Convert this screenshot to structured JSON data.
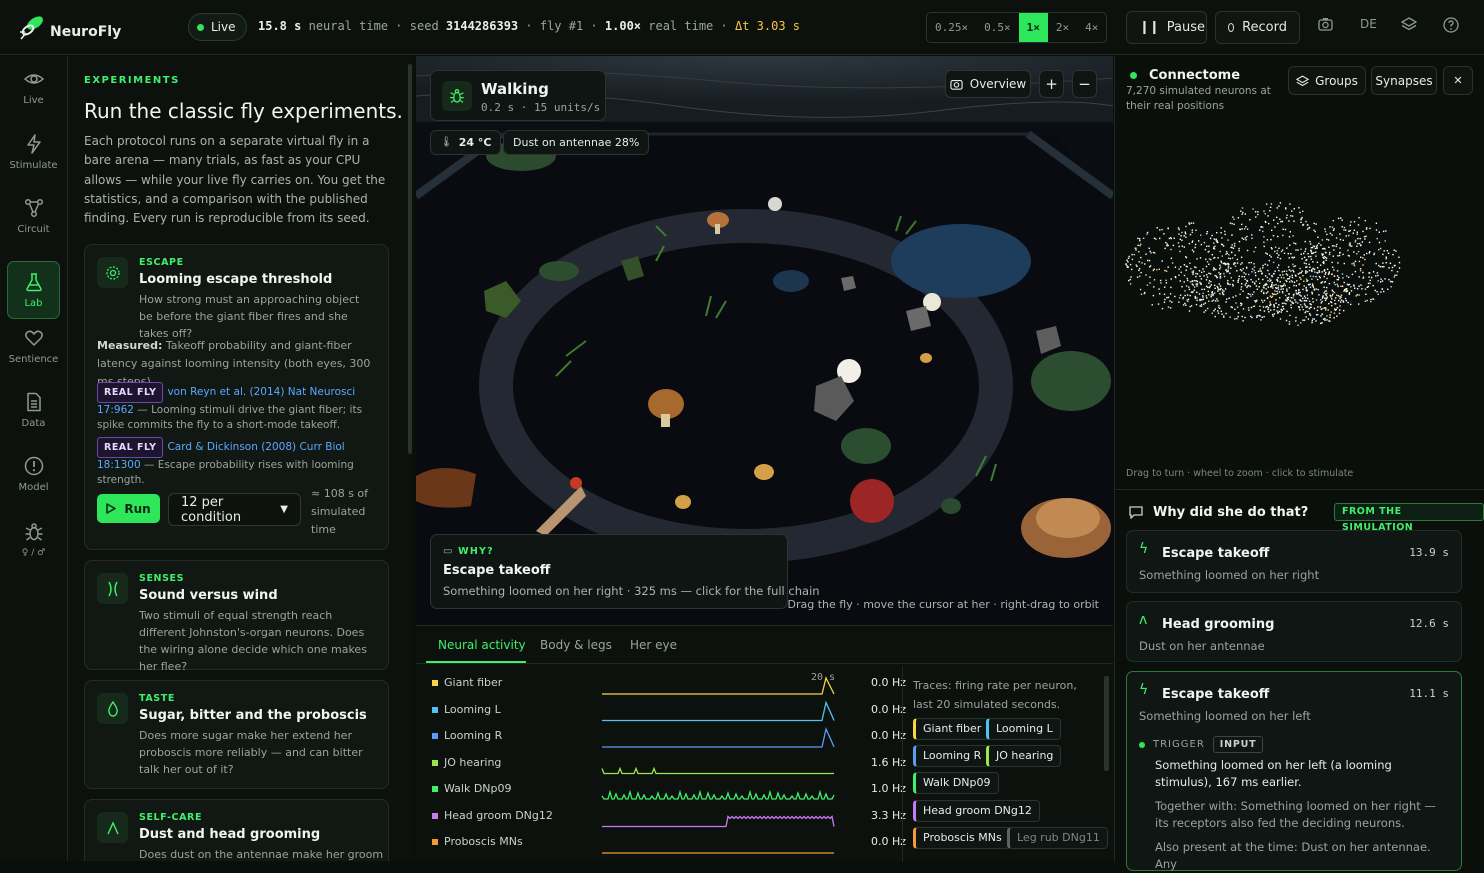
{
  "app": {
    "name": "NeuroFly"
  },
  "topbar": {
    "live_label": "Live",
    "time_value": "15.8 s",
    "time_label": "neural time",
    "seed_label": "seed",
    "seed_value": "3144286393",
    "fly_label": "fly #1",
    "ratio_value": "1.00×",
    "ratio_label": "real time",
    "dt_label": "Δt 3.03 s",
    "speeds": [
      "0.25×",
      "0.5×",
      "1×",
      "2×",
      "4×"
    ],
    "active_speed": "1×",
    "pause_label": "Pause",
    "record_label": "Record",
    "lang_label": "DE"
  },
  "nav": [
    {
      "label": "Live",
      "icon": "eye-icon"
    },
    {
      "label": "Stimulate",
      "icon": "lightning-icon"
    },
    {
      "label": "Circuit",
      "icon": "circuit-icon"
    },
    {
      "label": "Lab",
      "icon": "flask-icon",
      "active": true
    },
    {
      "label": "Sentience",
      "icon": "heart-icon"
    },
    {
      "label": "Data",
      "icon": "document-icon"
    },
    {
      "label": "Model",
      "icon": "info-icon"
    },
    {
      "label": "♀ / ♂",
      "icon": "bug-icon"
    }
  ],
  "lab": {
    "eyebrow": "EXPERIMENTS",
    "title": "Run the classic fly experiments.",
    "intro": "Each protocol runs on a separate virtual fly in a bare arena — many trials, as fast as your CPU allows — while your live fly carries on. You get the statistics, and a comparison with the published finding. Every run is reproducible from its seed.",
    "cards": [
      {
        "category": "ESCAPE",
        "title": "Looming escape threshold",
        "description": "How strong must an approaching object be before the giant fiber fires and she takes off?",
        "measured_label": "Measured:",
        "measured": "Takeoff probability and giant-fiber latency against looming intensity (both eyes, 300 ms steps).",
        "refs": [
          {
            "tag": "REAL FLY",
            "cite": "von Reyn et al. (2014) Nat Neurosci 17:962",
            "text": "— Looming stimuli drive the giant fiber; its spike commits the fly to a short-mode takeoff."
          },
          {
            "tag": "REAL FLY",
            "cite": "Card & Dickinson (2008) Curr Biol 18:1300",
            "text": "— Escape probability rises with looming strength."
          }
        ],
        "run_label": "Run",
        "select_value": "12 per condition",
        "estimate": "≈ 108 s of simulated time"
      },
      {
        "category": "SENSES",
        "title": "Sound versus wind",
        "description": "Two stimuli of equal strength reach different Johnston's-organ neurons. Does the wiring alone decide which one makes her flee?"
      },
      {
        "category": "TASTE",
        "title": "Sugar, bitter and the proboscis",
        "description": "Does more sugar make her extend her proboscis more reliably — and can bitter talk her out of it?"
      },
      {
        "category": "SELF-CARE",
        "title": "Dust and head grooming",
        "description": "Does dust on the antennae make her groom"
      }
    ]
  },
  "viewport": {
    "mode_title": "Walking",
    "mode_sub": "0.2 s · 15 units/s",
    "temp": "24 °C",
    "dust": "Dust on antennae 28%",
    "overview_label": "Overview",
    "zoom_in": "+",
    "zoom_out": "−",
    "why_label": "WHY?",
    "why_title": "Escape takeoff",
    "why_desc": "Something loomed on her right · 325 ms — click for the full chain",
    "hint": "Drag the fly · move the cursor at her · right-drag to orbit"
  },
  "bottom": {
    "tabs": [
      "Neural activity",
      "Body & legs",
      "Her eye"
    ],
    "window_label": "20 s",
    "traces": [
      {
        "name": "Giant fiber",
        "hz": "0.0 Hz",
        "color": "#f5d742"
      },
      {
        "name": "Looming L",
        "hz": "0.0 Hz",
        "color": "#4ec3f0"
      },
      {
        "name": "Looming R",
        "hz": "0.0 Hz",
        "color": "#5b9cf5"
      },
      {
        "name": "JO hearing",
        "hz": "1.6 Hz",
        "color": "#9be64a"
      },
      {
        "name": "Walk DNp09",
        "hz": "1.0 Hz",
        "color": "#3ef06a"
      },
      {
        "name": "Head groom DNg12",
        "hz": "3.3 Hz",
        "color": "#c77cf0"
      },
      {
        "name": "Proboscis MNs",
        "hz": "0.0 Hz",
        "color": "#f59a3a"
      }
    ],
    "note": "Traces: firing rate per neuron, last 20 simulated seconds.",
    "legend": [
      {
        "label": "Giant fiber",
        "color": "#f5d742"
      },
      {
        "label": "Looming L",
        "color": "#4ec3f0"
      },
      {
        "label": "Looming R",
        "color": "#5b9cf5"
      },
      {
        "label": "JO hearing",
        "color": "#9be64a"
      },
      {
        "label": "Walk DNp09",
        "color": "#3ef06a"
      },
      {
        "label": "Head groom DNg12",
        "color": "#c77cf0"
      },
      {
        "label": "Proboscis MNs",
        "color": "#f59a3a"
      },
      {
        "label": "Leg rub DNg11",
        "color": "#5a6560"
      }
    ]
  },
  "right": {
    "title": "Connectome",
    "subtitle": "7,270 simulated neurons at their real positions",
    "groups_label": "Groups",
    "synapses_label": "Synapses",
    "close": "✕",
    "hint": "Drag to turn · wheel to zoom · click to stimulate",
    "why_heading": "Why did she do that?",
    "from_sim": "FROM THE SIMULATION",
    "events": [
      {
        "title": "Escape takeoff",
        "time": "13.9 s",
        "desc": "Something loomed on her right",
        "icon": "lightning-icon"
      },
      {
        "title": "Head grooming",
        "time": "12.6 s",
        "desc": "Dust on her antennae",
        "icon": "groom-icon"
      },
      {
        "title": "Escape takeoff",
        "time": "11.1 s",
        "desc": "Something loomed on her left",
        "icon": "lightning-icon"
      }
    ],
    "trigger_label": "TRIGGER",
    "input_label": "INPUT",
    "trigger_text": "Something loomed on her left (a looming stimulus), 167 ms earlier.",
    "together_text": "Together with: Something loomed on her right — its receptors also fed the deciding neurons.",
    "also_text": "Also present at the time: Dust on her antennae. Any"
  }
}
